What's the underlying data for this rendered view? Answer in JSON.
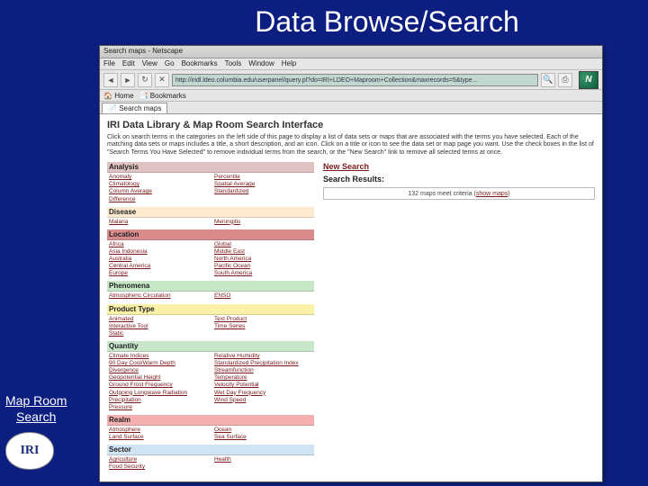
{
  "slide": {
    "title": "Data Browse/Search",
    "caption": "Map Room\nSearch",
    "badge": "IRI"
  },
  "browser": {
    "titlebar": "Search maps - Netscape",
    "menus": [
      "File",
      "Edit",
      "View",
      "Go",
      "Bookmarks",
      "Tools",
      "Window",
      "Help"
    ],
    "url": "http://iridl.ldeo.columbia.edu/userpanel/query.pl?do=IRI+LDEO+Maproom+Collection&maxrecords=5&type...",
    "bookmark_items": [
      "Home",
      "Bookmarks"
    ],
    "tab": "Search maps",
    "netscape": "N"
  },
  "page": {
    "heading": "IRI Data Library & Map Room Search Interface",
    "intro": "Click on search terms in the categories on the left side of this page to display a list of data sets or maps that are associated with the terms you have selected. Each of the matching data sets or maps includes a title, a short description, and an icon. Click on a title or icon to see the data set or map page you want. Use the check boxes in the list of \"Search Terms You Have Selected\" to remove individual terms from the search, or the \"New Search\" link to remove all selected terms at once.",
    "new_search": "New Search",
    "results_label": "Search Results:",
    "results_text_a": "132 maps meet criteria (",
    "results_showmaps": "show maps",
    "results_text_b": ")"
  },
  "categories": [
    {
      "name": "Analysis",
      "bg": "bg-analysis",
      "left": [
        "Anomaly",
        "Climatology",
        "Column Average",
        "Difference"
      ],
      "right": [
        "Percentile",
        "Spatial Average",
        "Standardized"
      ]
    },
    {
      "name": "Disease",
      "bg": "bg-disease",
      "left": [
        "Malaria"
      ],
      "right": [
        "Meningitis"
      ]
    },
    {
      "name": "Location",
      "bg": "bg-location",
      "left": [
        "Africa",
        "Asia Indonesia",
        "Australia",
        "Central America",
        "Europe"
      ],
      "right": [
        "Global",
        "Middle East",
        "North America",
        "Pacific Ocean",
        "South America"
      ]
    },
    {
      "name": "Phenomena",
      "bg": "bg-phenomena",
      "left": [
        "Atmospheric Circulation"
      ],
      "right": [
        "ENSO"
      ]
    },
    {
      "name": "Product Type",
      "bg": "bg-product",
      "left": [
        "Animated",
        "Interactive Tool",
        "Static"
      ],
      "right": [
        "Text Product",
        "Time Series"
      ]
    },
    {
      "name": "Quantity",
      "bg": "bg-quantity",
      "left": [
        "Climate Indices",
        "90 Day Cool/Warm Depth",
        "Divergence",
        "Geopotential Height",
        "Ground Frost Frequency",
        "Outgoing Longwave Radiation",
        "Precipitation",
        "Pressure"
      ],
      "right": [
        "Relative Humidity",
        "Standardized Precipitation Index",
        "Streamfunction",
        "Temperature",
        "Velocity Potential",
        "Wet Day Frequency",
        "Wind Speed"
      ]
    },
    {
      "name": "Realm",
      "bg": "bg-realm",
      "left": [
        "Atmosphere",
        "Land Surface"
      ],
      "right": [
        "Ocean",
        "Sea Surface"
      ]
    },
    {
      "name": "Sector",
      "bg": "bg-sector",
      "left": [
        "Agriculture",
        "Food Security"
      ],
      "right": [
        "Health"
      ]
    }
  ]
}
